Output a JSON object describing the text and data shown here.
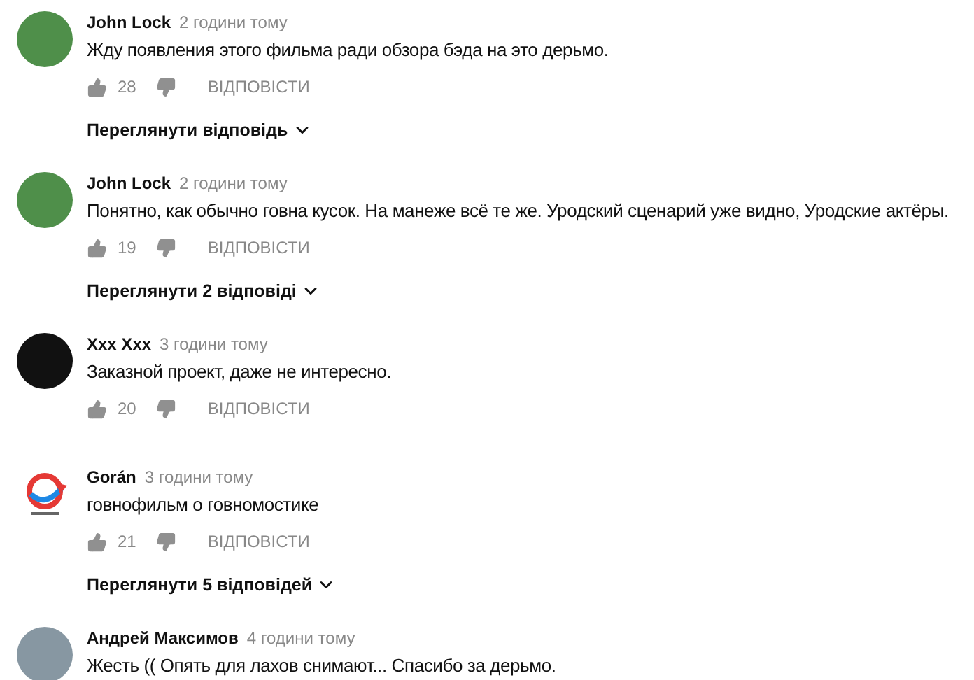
{
  "comments": [
    {
      "author": "John Lock",
      "time": "2 години тому",
      "text": "Жду появления этого фильма ради обзора бэда на это дерьмо.",
      "likes": "28",
      "reply": "ВІДПОВІСТИ",
      "replies": "Переглянути відповідь",
      "avatar": {
        "kind": "photo",
        "color": "#4f8f4a"
      }
    },
    {
      "author": "John Lock",
      "time": "2 години тому",
      "text": "Понятно, как обычно говна кусок. На манеже всё те же. Уродский сценарий уже видно, Уродские актёры.",
      "likes": "19",
      "reply": "ВІДПОВІСТИ",
      "replies": "Переглянути 2 відповіді",
      "avatar": {
        "kind": "photo",
        "color": "#4f8f4a"
      }
    },
    {
      "author": "Xxx Xxx",
      "time": "3 години тому",
      "text": "Заказной проект, даже не интересно.",
      "likes": "20",
      "reply": "ВІДПОВІСТИ",
      "avatar": {
        "kind": "photo",
        "color": "#111111"
      }
    },
    {
      "author": "Gorán",
      "time": "3 години тому",
      "text": "говнофильм о говномостике",
      "likes": "21",
      "reply": "ВІДПОВІСТИ",
      "replies": "Переглянути 5 відповідей",
      "avatar": {
        "kind": "logo",
        "color": "#e53935"
      }
    },
    {
      "author": "Андрей Максимов",
      "time": "4 години тому",
      "text": "Жесть (( Опять для лахов снимают... Спасибо за дерьмо.",
      "avatar": {
        "kind": "photo",
        "color": "#8797a2"
      }
    }
  ]
}
